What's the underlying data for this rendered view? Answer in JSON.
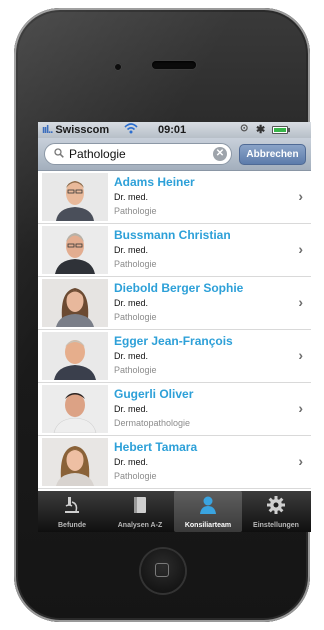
{
  "status_bar": {
    "signal": "ııl..",
    "carrier": "Swisscom",
    "time": "09:01"
  },
  "search": {
    "value": "Pathologie",
    "cancel_label": "Abbrechen"
  },
  "results": [
    {
      "name": "Adams Heiner",
      "title": "Dr. med.",
      "department": "Pathologie"
    },
    {
      "name": "Bussmann Christian",
      "title": "Dr. med.",
      "department": "Pathologie"
    },
    {
      "name": "Diebold Berger Sophie",
      "title": "Dr. med.",
      "department": "Pathologie"
    },
    {
      "name": "Egger Jean-François",
      "title": "Dr. med.",
      "department": "Pathologie"
    },
    {
      "name": "Gugerli Oliver",
      "title": "Dr. med.",
      "department": "Dermatopathologie"
    },
    {
      "name": "Hebert Tamara",
      "title": "Dr. med.",
      "department": "Pathologie"
    }
  ],
  "tabs": [
    {
      "label": "Befunde",
      "icon": "microscope-icon",
      "active": false
    },
    {
      "label": "Analysen A-Z",
      "icon": "book-icon",
      "active": false
    },
    {
      "label": "Konsiliarteam",
      "icon": "person-icon",
      "active": true
    },
    {
      "label": "Einstellungen",
      "icon": "gear-icon",
      "active": false
    }
  ],
  "colors": {
    "accent": "#2da0d8",
    "active_tab_icon": "#3aa4e0",
    "battery": "#39b54a"
  }
}
